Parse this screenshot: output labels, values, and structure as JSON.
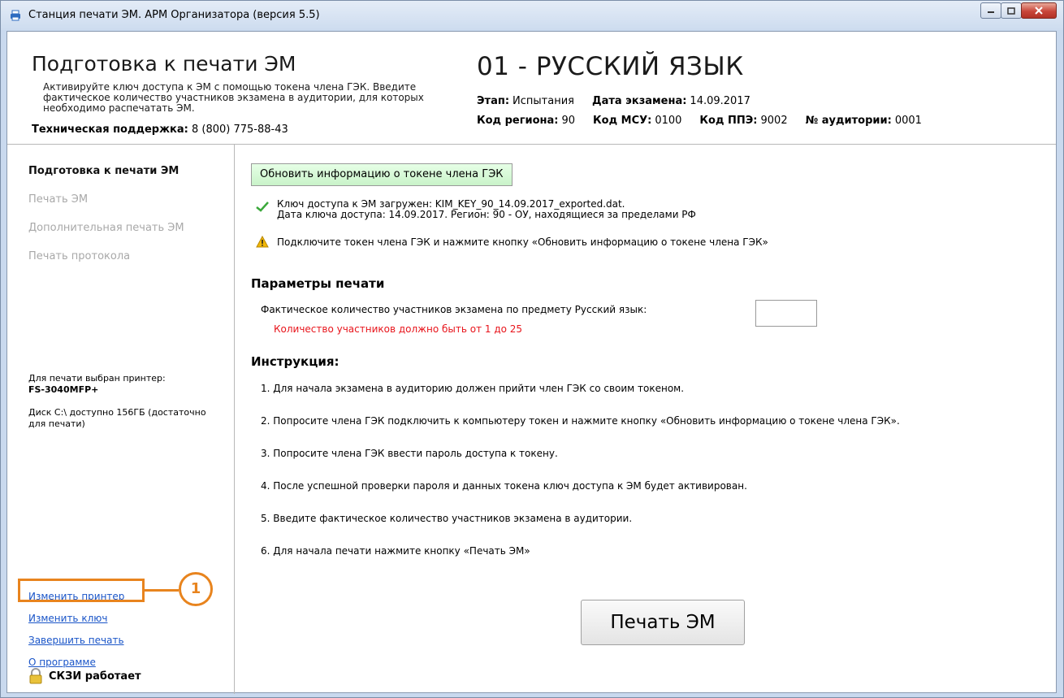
{
  "window": {
    "title": "Станция печати ЭМ. АРМ Организатора (версия 5.5)"
  },
  "header": {
    "title": "Подготовка к печати ЭМ",
    "description": "Активируйте ключ доступа к ЭМ с помощью токена члена ГЭК. Введите фактическое количество участников экзамена в аудитории, для которых необходимо распечатать ЭМ.",
    "support_label": "Техническая поддержка:",
    "support_phone": "8 (800) 775-88-43",
    "subject": "01 - РУССКИЙ ЯЗЫК",
    "stage_label": "Этап:",
    "stage_value": "Испытания",
    "exam_date_label": "Дата экзамена:",
    "exam_date_value": "14.09.2017",
    "region_label": "Код региона:",
    "region_value": "90",
    "msu_label": "Код МСУ:",
    "msu_value": "0100",
    "ppe_label": "Код ППЭ:",
    "ppe_value": "9002",
    "room_label": "№ аудитории:",
    "room_value": "0001"
  },
  "sidebar": {
    "nav": [
      {
        "label": "Подготовка к печати ЭМ",
        "state": "active"
      },
      {
        "label": "Печать ЭМ",
        "state": "disabled"
      },
      {
        "label": "Дополнительная печать ЭМ",
        "state": "disabled"
      },
      {
        "label": "Печать протокола",
        "state": "disabled"
      }
    ],
    "printer_label": "Для печати выбран принтер:",
    "printer_name": "FS-3040MFP+",
    "disk_info": "Диск C:\\ доступно 156ГБ (достаточно для печати)",
    "links": {
      "change_printer": "Изменить принтер",
      "change_key": "Изменить ключ",
      "finish_print": "Завершить печать",
      "about": "О программе"
    },
    "crypto_status": "СКЗИ работает"
  },
  "main": {
    "update_button": "Обновить информацию о токене члена ГЭК",
    "key_loaded": "Ключ доступа к ЭМ загружен: KIM_KEY_90_14.09.2017_exported.dat.",
    "key_date": "Дата ключа доступа: 14.09.2017. Регион: 90 - ОУ, находящиеся за пределами РФ",
    "warning": "Подключите токен члена ГЭК и нажмите кнопку «Обновить информацию о токене члена ГЭК»",
    "params_title": "Параметры печати",
    "count_label": "Фактическое количество участников экзамена по предмету Русский язык:",
    "count_value": "",
    "count_error": "Количество участников должно быть от 1 до 25",
    "instruction_title": "Инструкция:",
    "steps": [
      "1. Для начала экзамена в аудиторию должен прийти член ГЭК со своим токеном.",
      "2. Попросите члена ГЭК подключить к компьютеру токен и нажмите кнопку «Обновить информацию о токене члена ГЭК».",
      "3. Попросите члена ГЭК ввести пароль доступа к токену.",
      "4. После успешной проверки пароля и данных токена ключ доступа к ЭМ будет активирован.",
      "5. Введите фактическое количество участников экзамена в аудитории.",
      "6. Для начала печати нажмите кнопку «Печать ЭМ»"
    ],
    "print_button": "Печать ЭМ"
  },
  "callout": {
    "number": "1",
    "color": "#e8841e"
  },
  "colors": {
    "link": "#1a55c8",
    "error": "#e8141b",
    "disabled": "#a8a8a8",
    "ok_check": "#3aa83a",
    "warning": "#f2b705"
  }
}
